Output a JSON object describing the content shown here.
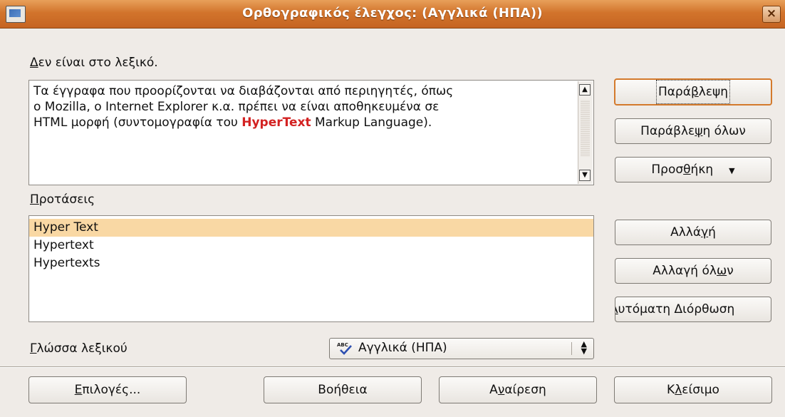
{
  "window": {
    "title": "Ορθογραφικός έλεγχος: (Αγγλικά (ΗΠΑ))",
    "close_label": "×"
  },
  "not_in_dictionary": {
    "label_first": "Δ",
    "label_rest": "εν είναι στο λεξικό.",
    "line1": "Τα έγγραφα που προορίζονται να διαβάζονται από περιηγητές, όπως",
    "line2": "ο Mozilla, ο Internet Explorer κ.α. πρέπει να είναι αποθηκευμένα σε",
    "line3_before": "HTML μορφή (συντομογραφία του ",
    "line3_error": "HyperText",
    "line3_after": " Markup Language)."
  },
  "suggestions": {
    "label_first": "Π",
    "label_rest": "ροτάσεις",
    "items": [
      "Hyper Text",
      "Hypertext",
      "Hypertexts"
    ],
    "selected_index": 0
  },
  "language": {
    "label_first": "Γ",
    "label_rest": "λώσσα λεξικού",
    "value": "Αγγλικά (ΗΠΑ)",
    "icon_text": "ABC"
  },
  "side_buttons": {
    "ignore_a": "Παρά",
    "ignore_u": "β",
    "ignore_b": "λεψη",
    "ignore_all_a": "Παράβλε",
    "ignore_all_u": "ψ",
    "ignore_all_b": "η όλων",
    "add_a": "Προσ",
    "add_u": "θ",
    "add_b": "ήκη",
    "change_a": "Αλλά",
    "change_u": "γ",
    "change_b": "ή",
    "change_all_a": "Αλλαγή όλ",
    "change_all_u": "ω",
    "change_all_b": "ν",
    "autocorrect_u": "Α",
    "autocorrect_b": "υτόματη Διόρθωση"
  },
  "bottom_buttons": {
    "options_u": "Ε",
    "options_b": "πιλογές...",
    "help": "Βοήθεια",
    "undo_a": "Α",
    "undo_u": "ν",
    "undo_b": "αίρεση",
    "close_a": "Κ",
    "close_u": "λ",
    "close_b": "είσιμο"
  }
}
